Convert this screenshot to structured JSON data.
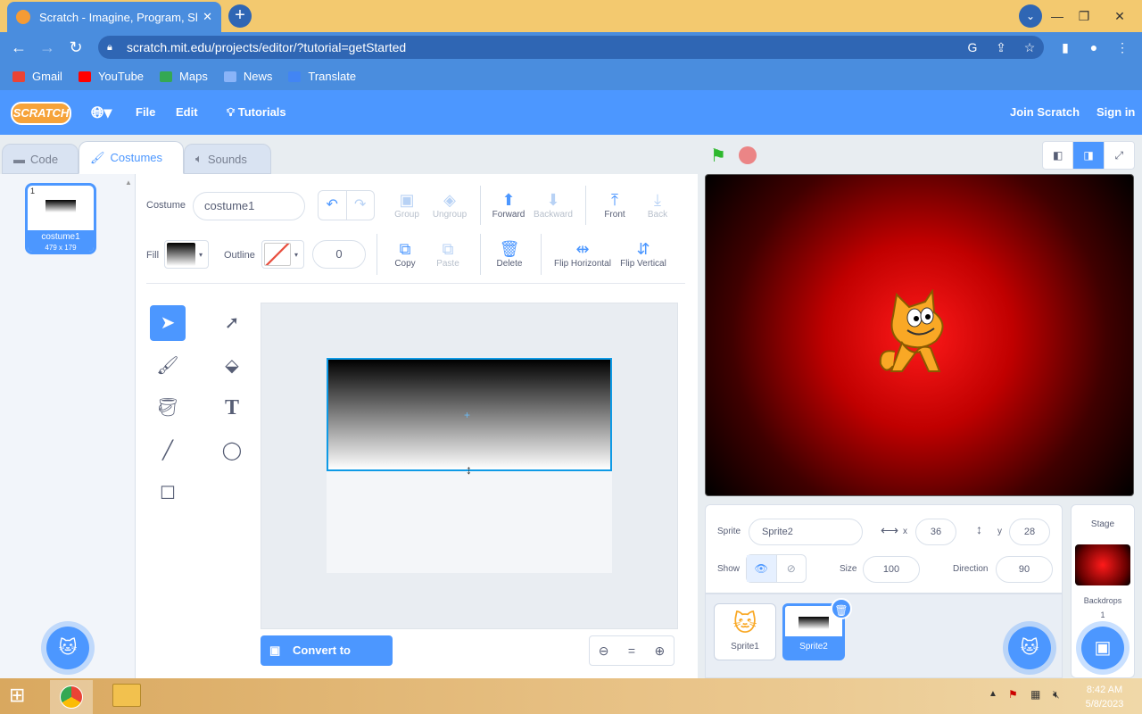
{
  "browser": {
    "tab_title": "Scratch - Imagine, Program, Share",
    "url": "scratch.mit.edu/projects/editor/?tutorial=getStarted",
    "bookmarks": [
      "Gmail",
      "YouTube",
      "Maps",
      "News",
      "Translate"
    ],
    "colors": {
      "tabbar": "#f3c96f",
      "toolbar": "#4a8dde"
    }
  },
  "menu": {
    "logo": "SCRATCH",
    "file": "File",
    "edit": "Edit",
    "tutorials": "Tutorials",
    "join": "Join Scratch",
    "signin": "Sign in"
  },
  "tabs": {
    "code": "Code",
    "costumes": "Costumes",
    "sounds": "Sounds"
  },
  "costume_list": [
    {
      "number": "1",
      "name": "costume1",
      "size": "479 x 179"
    }
  ],
  "paint": {
    "costume_label": "Costume",
    "costume_name": "costume1",
    "group": "Group",
    "ungroup": "Ungroup",
    "forward": "Forward",
    "backward": "Backward",
    "front": "Front",
    "back": "Back",
    "fill_label": "Fill",
    "outline_label": "Outline",
    "outline_width": "0",
    "copy": "Copy",
    "paste": "Paste",
    "delete": "Delete",
    "flip_h": "Flip Horizontal",
    "flip_v": "Flip Vertical",
    "convert": "Convert to Bitmap",
    "zoom_reset": "="
  },
  "sprite_info": {
    "sprite_label": "Sprite",
    "sprite_name": "Sprite2",
    "x_label": "x",
    "x": "36",
    "y_label": "y",
    "y": "28",
    "show_label": "Show",
    "size_label": "Size",
    "size": "100",
    "direction_label": "Direction",
    "direction": "90"
  },
  "sprites": [
    {
      "name": "Sprite1"
    },
    {
      "name": "Sprite2"
    }
  ],
  "stage_panel": {
    "title": "Stage",
    "backdrops_label": "Backdrops",
    "backdrops_count": "1"
  },
  "taskbar": {
    "time": "8:42 AM",
    "date": "5/8/2023"
  },
  "accent_color": "#4c97ff"
}
